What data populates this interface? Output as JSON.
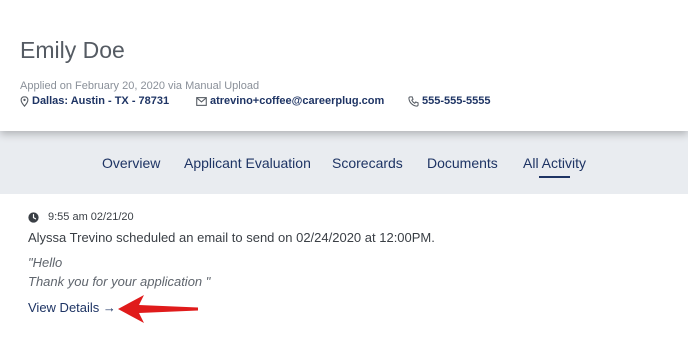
{
  "applicant": {
    "name": "Emily Doe",
    "applied": "Applied on February 20, 2020 via Manual Upload",
    "location": "Dallas: Austin - TX - 78731",
    "email": "atrevino+coffee@careerplug.com",
    "phone": "555-555-5555"
  },
  "tabs": [
    {
      "label": "Overview"
    },
    {
      "label": "Applicant Evaluation"
    },
    {
      "label": "Scorecards"
    },
    {
      "label": "Documents"
    },
    {
      "label": "All Activity",
      "active": true
    }
  ],
  "activity": {
    "timestamp": "9:55 am 02/21/20",
    "text": "Alyssa Trevino scheduled an email to send on 02/24/2020 at 12:00PM.",
    "quote_line1": "\"Hello",
    "quote_line2": "Thank you for your application \"",
    "link": "View Details →"
  },
  "colors": {
    "brand": "#1e3464",
    "tab_bar": "#e9ecf0",
    "pointer": "#e01b1b"
  }
}
